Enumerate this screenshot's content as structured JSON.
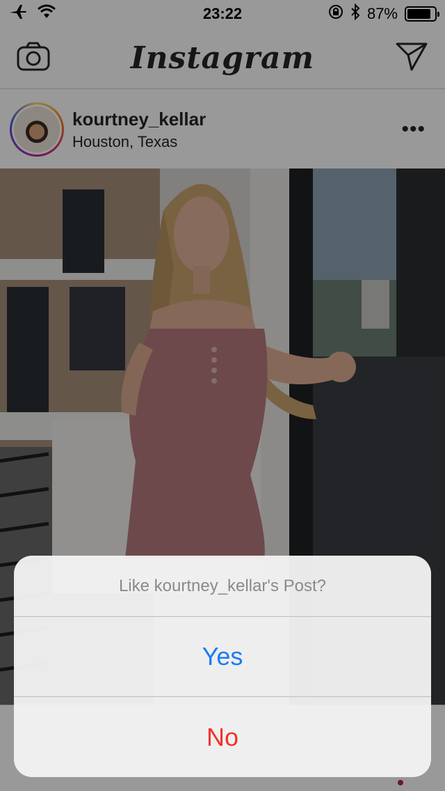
{
  "status_bar": {
    "time": "23:22",
    "battery_percent_label": "87%",
    "battery_level": 0.87,
    "icons": [
      "airplane-icon",
      "wifi-icon",
      "orientation-lock-icon",
      "bluetooth-icon",
      "battery-icon"
    ]
  },
  "nav": {
    "brand": "Instagram",
    "left_icon": "camera-icon",
    "right_icon": "direct-message-icon"
  },
  "post": {
    "username": "kourtney_kellar",
    "location": "Houston, Texas",
    "more_label": "•••"
  },
  "alert": {
    "title": "Like kourtney_kellar's Post?",
    "yes_label": "Yes",
    "no_label": "No"
  },
  "colors": {
    "accent_blue": "#1a7cf4",
    "destructive_red": "#f2322c",
    "text_dark": "#262626"
  }
}
